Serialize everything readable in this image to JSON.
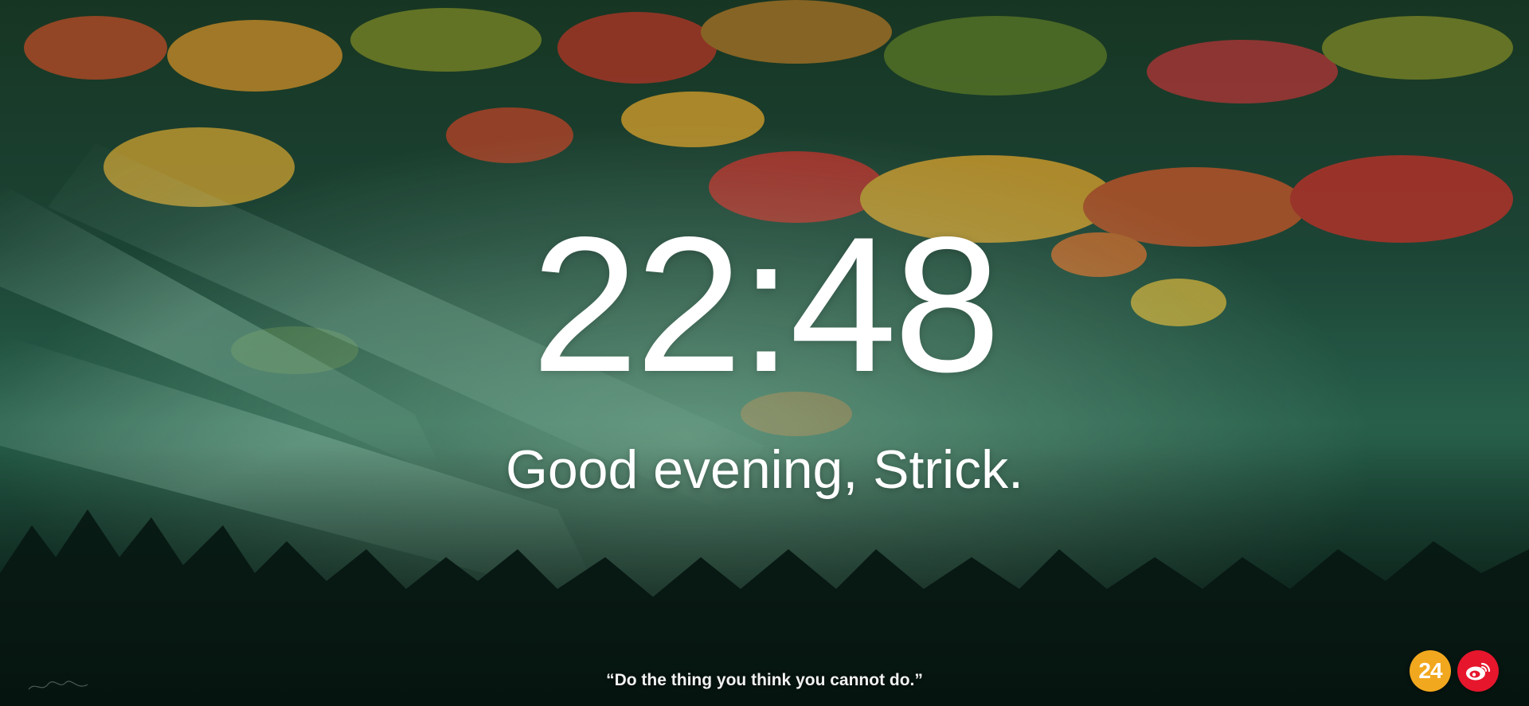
{
  "clock": {
    "time": "22:48"
  },
  "greeting": {
    "text": "Good evening, Strick."
  },
  "quote": {
    "text": "“Do the thing you think you cannot do.”"
  },
  "badges": [
    {
      "name": "24-badge",
      "label": "24",
      "color": "#f2a81e"
    },
    {
      "name": "weibo-badge",
      "icon": "weibo-icon",
      "color": "#e6162d"
    }
  ],
  "background": {
    "description_colors": [
      "#0d2a22",
      "#2f6b55",
      "#d26a2a",
      "#c33a2a",
      "#d9b23a",
      "#8fc7b0"
    ]
  }
}
